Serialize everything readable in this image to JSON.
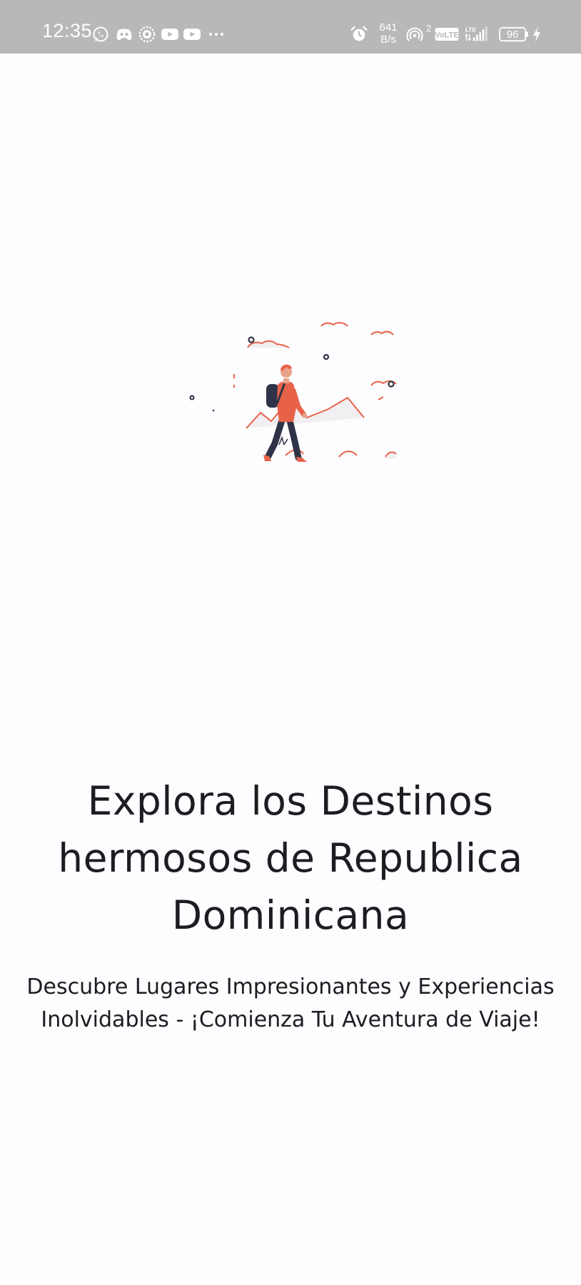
{
  "status_bar": {
    "time": "12:35",
    "net_speed_value": "641",
    "net_speed_unit": "B/s",
    "signal_sup": "2",
    "volte_label": "VoLTE",
    "lte_label": "LTE",
    "battery": "96",
    "notification_icons": [
      "whatsapp-icon",
      "discord-icon",
      "settings-icon",
      "youtube-icon",
      "youtube-icon",
      "more-dots-icon"
    ],
    "system_icons": [
      "alarm-icon",
      "hotspot-icon",
      "volte-icon",
      "lte-signal-icon",
      "battery-icon",
      "charging-icon"
    ]
  },
  "onboarding": {
    "headline": "Explora los Destinos hermosos de Republica Dominicana",
    "tagline": "Descubre Lugares Impresionantes y Experiencias Inolvidables - ¡Comienza Tu Aventura de Viaje!",
    "illustration": "traveler-hiking-illustration"
  },
  "colors": {
    "status_bar_bg": "#b8b8bb",
    "background": "#fdfcff",
    "text": "#1d1c21",
    "accent": "#e8624a",
    "dark": "#2f3347"
  }
}
